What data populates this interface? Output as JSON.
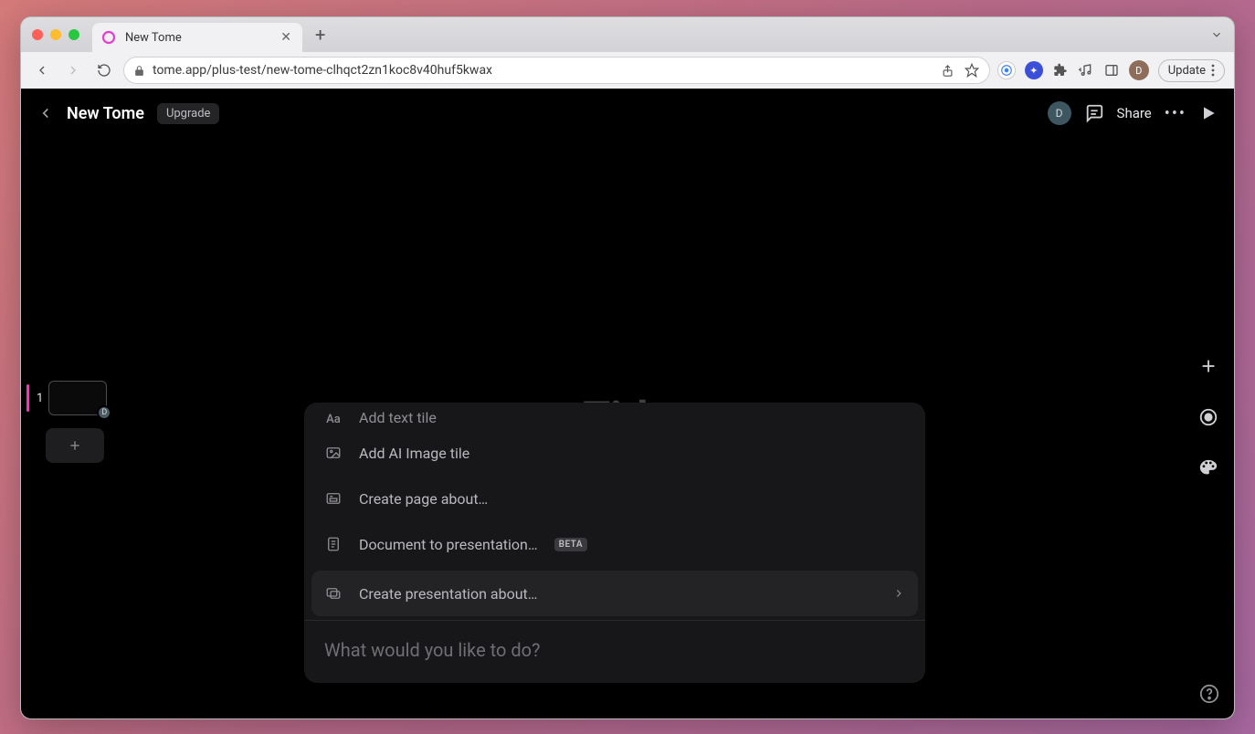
{
  "browser": {
    "tab_title": "New Tome",
    "url": "tome.app/plus-test/new-tome-clhqct2zn1koc8v40huf5kwax",
    "update_label": "Update",
    "profile_initial": "D"
  },
  "app": {
    "title": "New Tome",
    "upgrade_label": "Upgrade",
    "share_label": "Share",
    "avatar_initial": "D",
    "canvas_title_placeholder": "Title",
    "page_number": "1",
    "thumb_badge": "D"
  },
  "menu": {
    "items": [
      {
        "label": "Add text tile",
        "icon": "text-icon"
      },
      {
        "label": "Add AI Image tile",
        "icon": "image-icon"
      },
      {
        "label": "Create page about…",
        "icon": "page-icon"
      },
      {
        "label": "Document to presentation…",
        "icon": "document-icon",
        "beta": "BETA"
      },
      {
        "label": "Create presentation about…",
        "icon": "presentation-icon",
        "active": true
      }
    ],
    "input_placeholder": "What would you like to do?"
  }
}
